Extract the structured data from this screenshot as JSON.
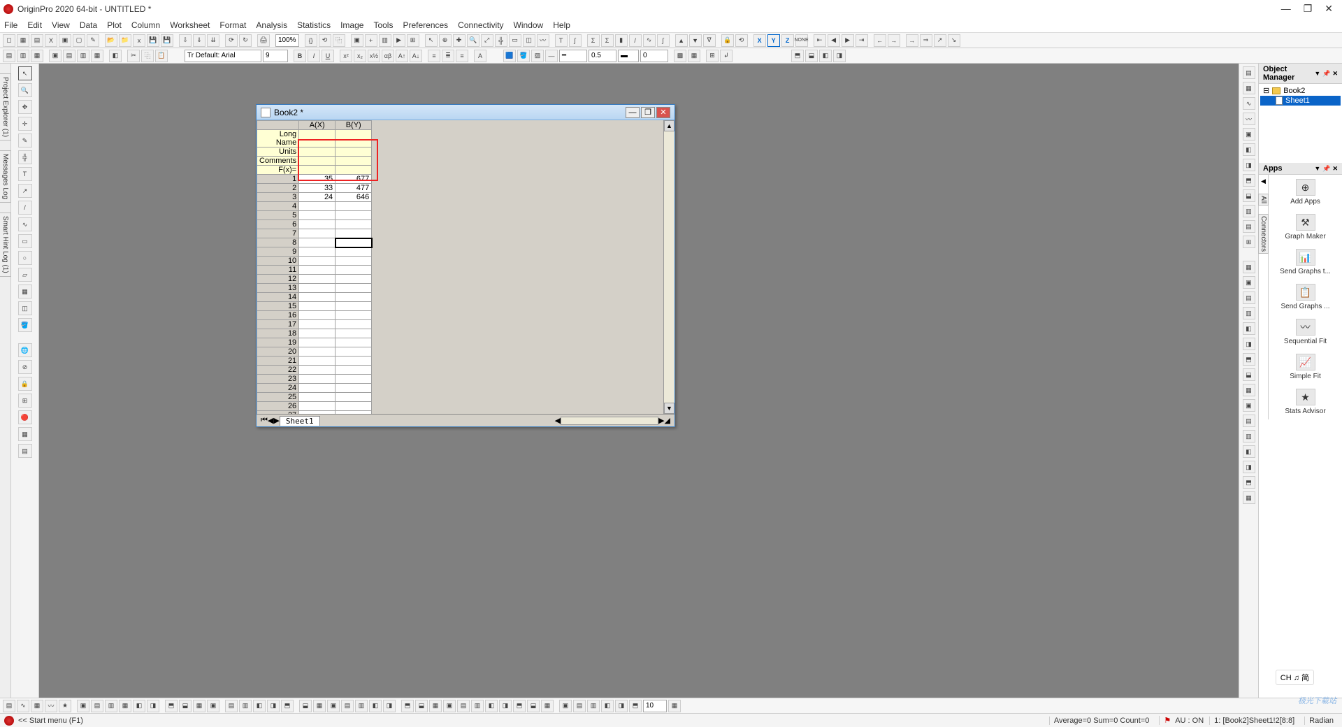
{
  "app": {
    "title": "OriginPro 2020 64-bit - UNTITLED *",
    "window_buttons": [
      "—",
      "❐",
      "✕"
    ]
  },
  "menu": [
    "File",
    "Edit",
    "View",
    "Data",
    "Plot",
    "Column",
    "Worksheet",
    "Format",
    "Analysis",
    "Statistics",
    "Image",
    "Tools",
    "Preferences",
    "Connectivity",
    "Window",
    "Help"
  ],
  "toolbar1": {
    "zoom": "100%"
  },
  "toolbar2": {
    "font_label": "Tr Default: Arial",
    "font_size": "9",
    "line_w": "0.5",
    "other_num": "0"
  },
  "object_manager": {
    "title": "Object Manager",
    "items": [
      {
        "label": "Book2",
        "selected": false,
        "type": "book"
      },
      {
        "label": "Sheet1",
        "selected": true,
        "type": "sheet"
      }
    ]
  },
  "apps_panel": {
    "title": "Apps",
    "tabs": [
      "All",
      "Connectors"
    ],
    "tiles": [
      {
        "label": "Add Apps",
        "icon": "⊕"
      },
      {
        "label": "Graph Maker",
        "icon": "⚒"
      },
      {
        "label": "Send Graphs t...",
        "icon": "📊"
      },
      {
        "label": "Send Graphs ...",
        "icon": "📋"
      },
      {
        "label": "Sequential Fit",
        "icon": "〰"
      },
      {
        "label": "Simple Fit",
        "icon": "📈"
      },
      {
        "label": "Stats Advisor",
        "icon": "★"
      }
    ]
  },
  "worksheet": {
    "title": "Book2 *",
    "columns": [
      {
        "name": "A(X)"
      },
      {
        "name": "B(Y)"
      }
    ],
    "meta_rows": [
      "Long Name",
      "Units",
      "Comments",
      "F(x)="
    ],
    "data": {
      "1": {
        "A": "35",
        "B": "677"
      },
      "2": {
        "A": "33",
        "B": "477"
      },
      "3": {
        "A": "24",
        "B": "646"
      }
    },
    "row_count": 28,
    "selected_cell": {
      "row": 8,
      "col": "B"
    },
    "sheet_tab": "Sheet1"
  },
  "statusbar": {
    "left": "<< Start menu (F1)",
    "stats": "Average=0 Sum=0 Count=0",
    "au": "AU : ON",
    "loc": "1: [Book2]Sheet1!2[8:8]",
    "angle": "Radian"
  },
  "bottom_combo": "10",
  "lang": "CH ♫ 简",
  "watermark": "极光下载站"
}
